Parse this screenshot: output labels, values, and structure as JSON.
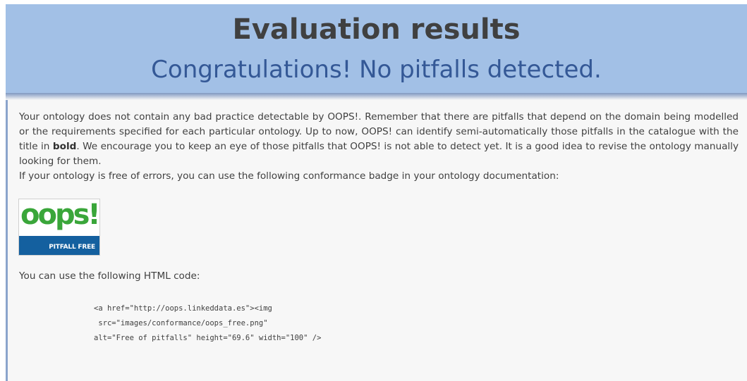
{
  "header": {
    "title": "Evaluation results",
    "subtitle": "Congratulations! No pitfalls detected."
  },
  "description": {
    "part1": "Your ontology does not contain any bad practice detectable by OOPS!. Remember that there are pitfalls that depend on the domain being modelled or the requirements specified for each particular ontology. Up to now, OOPS! can identify semi-automatically those pitfalls in the catalogue with the title in ",
    "bold": "bold",
    "part2": ". We encourage you to keep an eye of those pitfalls that OOPS! is not able to detect yet. It is a good idea to revise the ontology manually looking for them.",
    "badge_intro": "If your ontology is free of errors, you can use the following conformance badge in your ontology documentation:"
  },
  "badge": {
    "logo_text": "oops!",
    "caption": "PITFALL FREE",
    "logo_color": "#3aa63a",
    "band_color": "#14609f"
  },
  "html_code": {
    "label": "You can use the following HTML code:",
    "line1": "<a href=\"http://oops.linkeddata.es\"><img",
    "line2": " src=\"images/conformance/oops_free.png\"",
    "line3": "alt=\"Free of pitfalls\" height=\"69.6\" width=\"100\" />"
  }
}
